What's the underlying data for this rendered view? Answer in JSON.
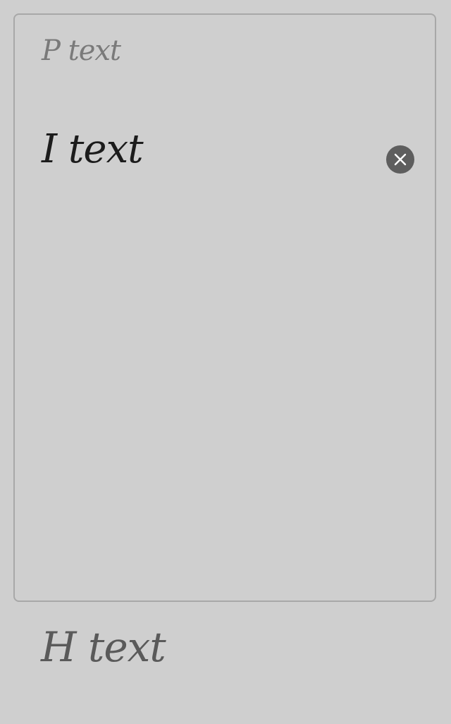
{
  "field": {
    "placeholder_label": "P text",
    "value": "I text",
    "clear_icon": "close-icon"
  },
  "helper": {
    "text": "H text"
  },
  "colors": {
    "background": "#cfcfcf",
    "border": "#a8a8a8",
    "placeholder": "#7a7a7a",
    "value": "#1c1c1c",
    "clear_button": "#5e5e5e",
    "helper": "#5a5a5a"
  }
}
